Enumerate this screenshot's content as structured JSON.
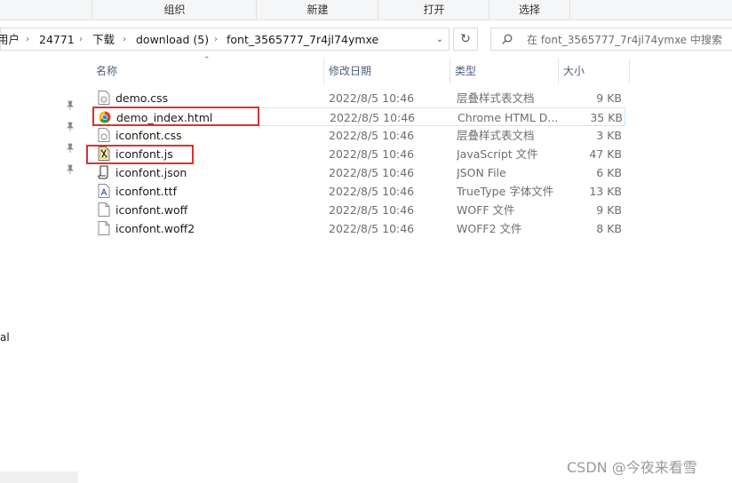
{
  "ribbon": {
    "groups": [
      "组织",
      "新建",
      "打开",
      "选择"
    ]
  },
  "address": {
    "crumbs": [
      "用户",
      "24771",
      "下载",
      "download (5)",
      "font_3565777_7r4jl74ymxe"
    ]
  },
  "search": {
    "placeholder": "在 font_3565777_7r4jl74ymxe 中搜索"
  },
  "nav": {
    "partial_item": "al"
  },
  "columns": {
    "name": "名称",
    "date": "修改日期",
    "type": "类型",
    "size": "大小"
  },
  "files": [
    {
      "name": "demo.css",
      "date": "2022/8/5 10:46",
      "type": "层叠样式表文档",
      "size": "9 KB",
      "icon": "css-file-icon"
    },
    {
      "name": "demo_index.html",
      "date": "2022/8/5 10:46",
      "type": "Chrome HTML D...",
      "size": "35 KB",
      "icon": "chrome-html-icon"
    },
    {
      "name": "iconfont.css",
      "date": "2022/8/5 10:46",
      "type": "层叠样式表文档",
      "size": "3 KB",
      "icon": "css-file-icon"
    },
    {
      "name": "iconfont.js",
      "date": "2022/8/5 10:46",
      "type": "JavaScript 文件",
      "size": "47 KB",
      "icon": "js-file-icon"
    },
    {
      "name": "iconfont.json",
      "date": "2022/8/5 10:46",
      "type": "JSON File",
      "size": "6 KB",
      "icon": "json-file-icon"
    },
    {
      "name": "iconfont.ttf",
      "date": "2022/8/5 10:46",
      "type": "TrueType 字体文件",
      "size": "13 KB",
      "icon": "font-file-icon"
    },
    {
      "name": "iconfont.woff",
      "date": "2022/8/5 10:46",
      "type": "WOFF 文件",
      "size": "9 KB",
      "icon": "blank-file-icon"
    },
    {
      "name": "iconfont.woff2",
      "date": "2022/8/5 10:46",
      "type": "WOFF2 文件",
      "size": "8 KB",
      "icon": "blank-file-icon"
    }
  ],
  "watermark": "CSDN @今夜来看雪",
  "colors": {
    "annotation": "#e03030",
    "selection_border": "#cde8ff",
    "header_text": "#4c607a"
  }
}
